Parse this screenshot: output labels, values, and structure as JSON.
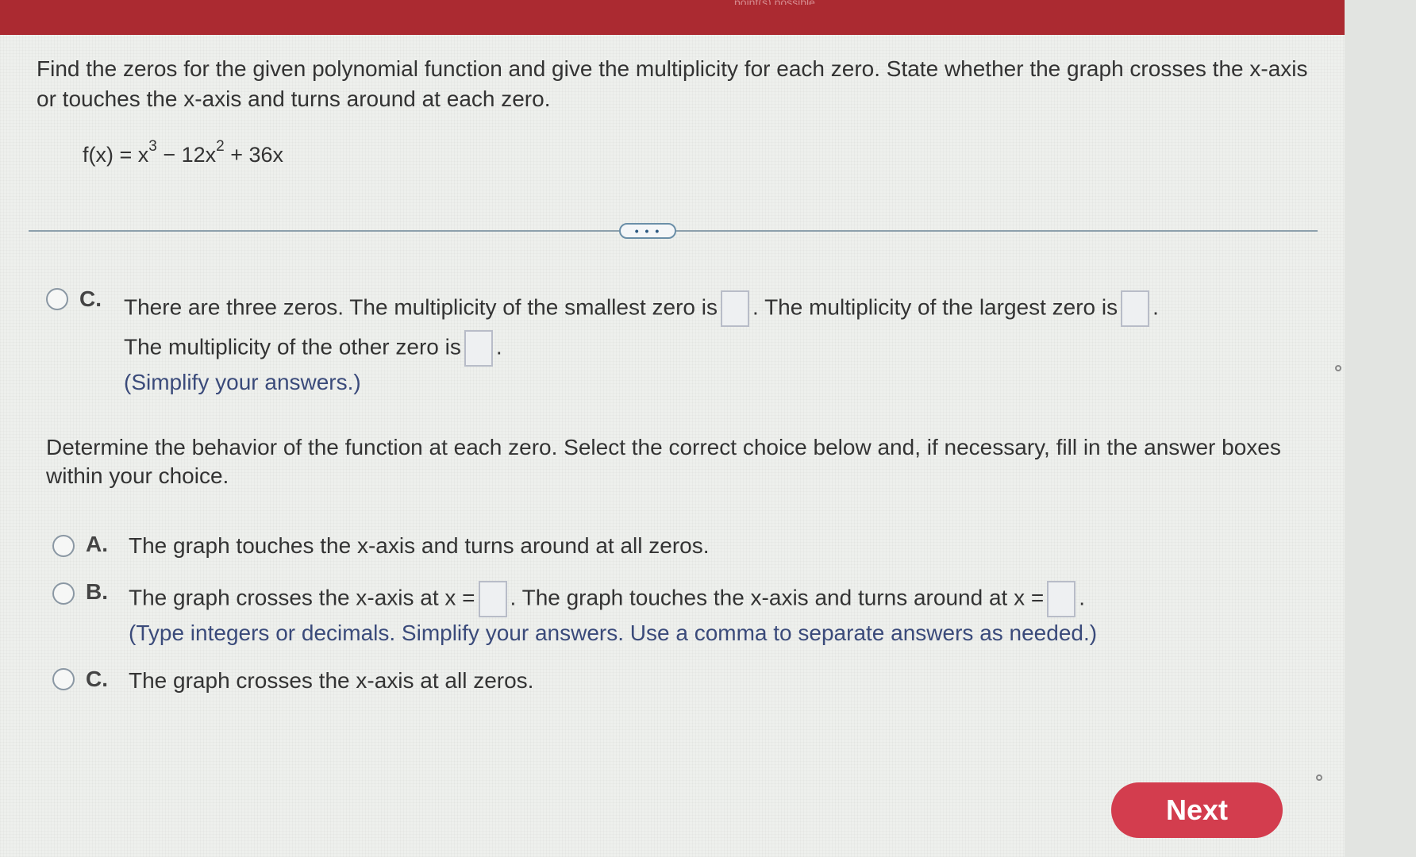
{
  "question": {
    "text": "Find the zeros for the given polynomial function and give the multiplicity for each zero. State whether the graph crosses the x-axis or touches the x-axis and turns around at each zero."
  },
  "function": {
    "lhs": "f(x) = x",
    "exp1": "3",
    "mid": " − 12x",
    "exp2": "2",
    "tail": " + 36x"
  },
  "more_label": "• • •",
  "part1": {
    "optionC": {
      "letter": "C.",
      "line1_a": "There are three zeros. The multiplicity of the smallest zero is",
      "line1_b": ". The multiplicity of the largest zero is",
      "line1_c": ".",
      "line2_a": "The multiplicity of the other zero is",
      "line2_b": ".",
      "hint": "(Simplify your answers.)"
    }
  },
  "behavior": {
    "prompt": "Determine the behavior of the function at each zero. Select the correct choice below and, if necessary, fill in the answer boxes within your choice.",
    "options": [
      {
        "letter": "A.",
        "text": "The graph touches the x-axis and turns around at all zeros."
      },
      {
        "letter": "B.",
        "text_a": "The graph crosses the x-axis at x =",
        "text_b": ". The graph touches the x-axis and turns around at x =",
        "text_c": ".",
        "hint": "(Type integers or decimals. Simplify your answers. Use a comma to separate answers as needed.)"
      },
      {
        "letter": "C.",
        "text": "The graph crosses the x-axis at all zeros."
      }
    ]
  },
  "next_label": "Next",
  "top_bar_faint": "point(s) possible"
}
